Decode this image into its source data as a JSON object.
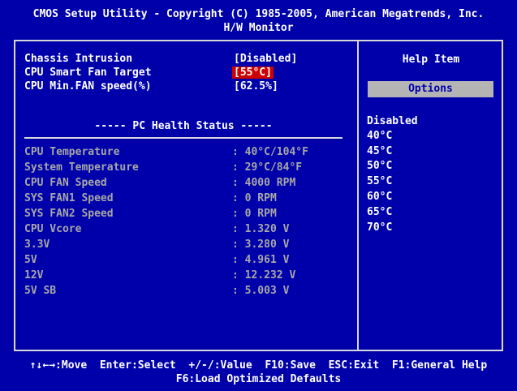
{
  "header": {
    "title": "CMOS Setup Utility - Copyright (C) 1985-2005, American Megatrends, Inc.",
    "subtitle": "H/W Monitor"
  },
  "settings": [
    {
      "label": "Chassis Intrusion",
      "value": "[Disabled]"
    },
    {
      "label": "CPU Smart Fan Target",
      "value": "[55°C]",
      "selected": true
    },
    {
      "label": "CPU Min.FAN speed(%)",
      "value": "[62.5%]"
    }
  ],
  "health": {
    "title": "----- PC Health Status -----",
    "rows": [
      {
        "label": "CPU Temperature",
        "value": ": 40°C/104°F"
      },
      {
        "label": "System Temperature",
        "value": ": 29°C/84°F"
      },
      {
        "label": "CPU FAN Speed",
        "value": ": 4000 RPM"
      },
      {
        "label": "SYS FAN1 Speed",
        "value": ": 0 RPM"
      },
      {
        "label": "SYS FAN2 Speed",
        "value": ": 0 RPM"
      },
      {
        "label": "CPU Vcore",
        "value": ": 1.320 V"
      },
      {
        "label": "3.3V",
        "value": ": 3.280 V"
      },
      {
        "label": "5V",
        "value": ": 4.961 V"
      },
      {
        "label": "12V",
        "value": ": 12.232 V"
      },
      {
        "label": "5V SB",
        "value": ": 5.003 V"
      }
    ]
  },
  "help": {
    "title": "Help Item",
    "options_label": "Options",
    "options": [
      "Disabled",
      "40°C",
      "45°C",
      "50°C",
      "55°C",
      "60°C",
      "65°C",
      "70°C"
    ]
  },
  "footer": {
    "line1": "↑↓←→:Move  Enter:Select  +/-/:Value  F10:Save  ESC:Exit  F1:General Help",
    "line2": "F6:Load Optimized Defaults"
  },
  "colors": {
    "background": "#0000aa",
    "highlight": "#cc0000",
    "disabled_text": "#a8a8a8",
    "options_bar": "#b4b4b4"
  }
}
